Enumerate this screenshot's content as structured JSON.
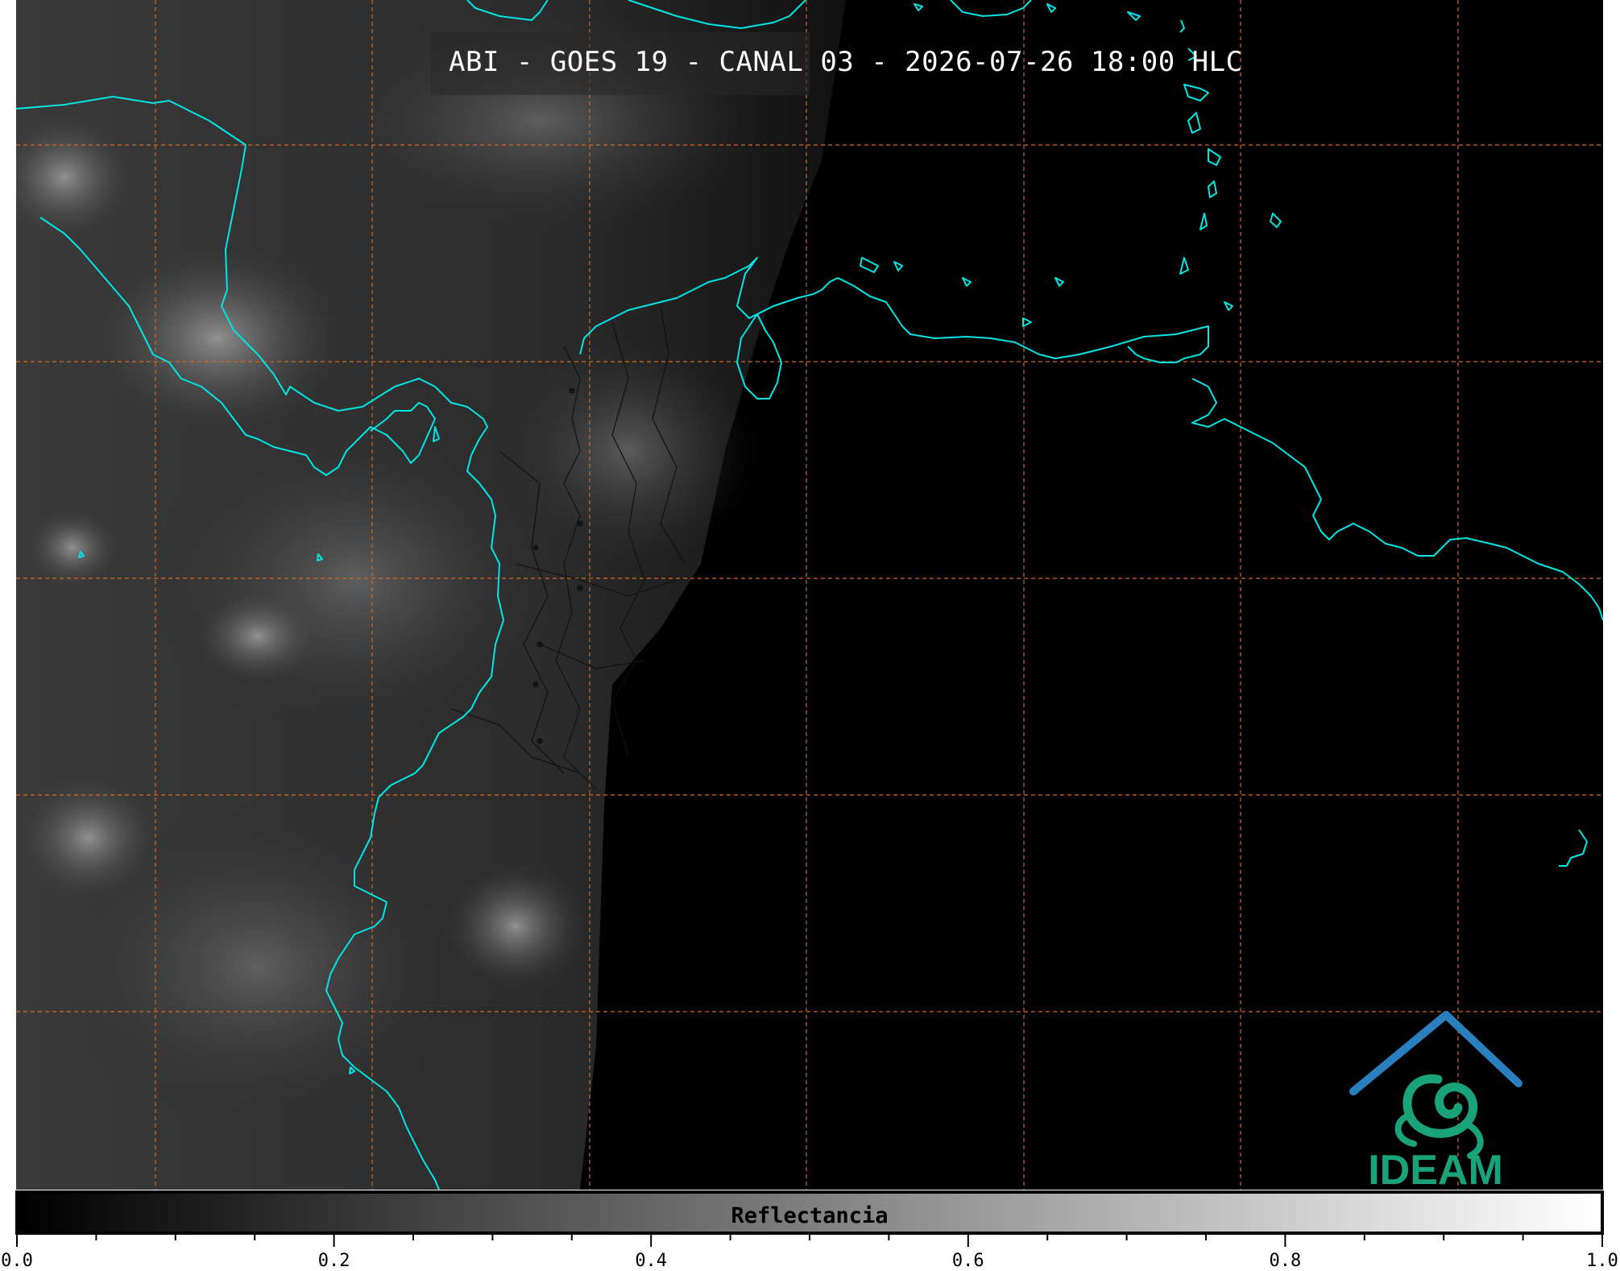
{
  "title": "ABI - GOES 19 - CANAL 03 - 2026-07-26 18:00 HLC",
  "colorbar": {
    "label": "Reflectancia",
    "min": 0.0,
    "max": 1.0,
    "ticks": [
      "0.0",
      "0.2",
      "0.4",
      "0.6",
      "0.8",
      "1.0"
    ]
  },
  "logo": {
    "text": "IDEAM",
    "color": "#1aa37a",
    "accent": "#2a7fbf"
  },
  "colors": {
    "coastline": "#00e5e5",
    "grid": "#d2691e",
    "background": "#000000"
  }
}
